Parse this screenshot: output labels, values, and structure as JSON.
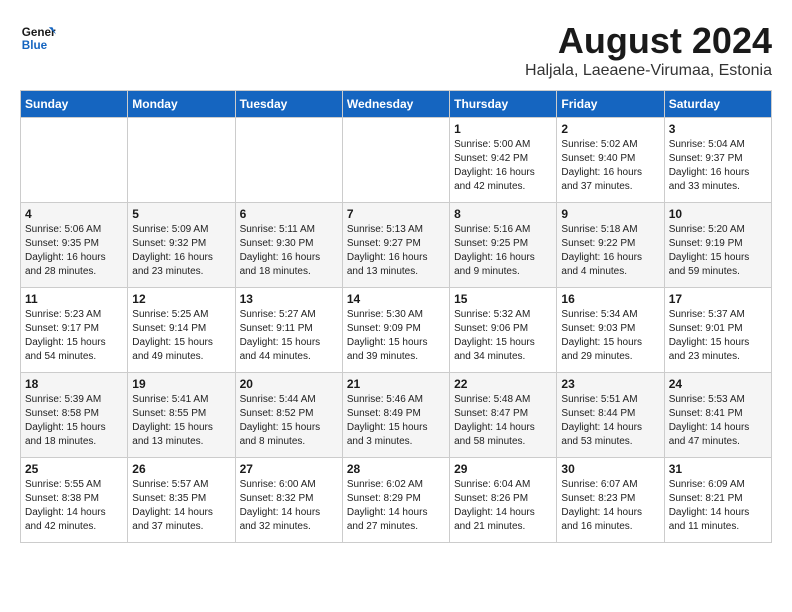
{
  "logo": {
    "line1": "General",
    "line2": "Blue"
  },
  "title": "August 2024",
  "subtitle": "Haljala, Laeaene-Virumaa, Estonia",
  "days_of_week": [
    "Sunday",
    "Monday",
    "Tuesday",
    "Wednesday",
    "Thursday",
    "Friday",
    "Saturday"
  ],
  "weeks": [
    [
      {
        "day": "",
        "info": ""
      },
      {
        "day": "",
        "info": ""
      },
      {
        "day": "",
        "info": ""
      },
      {
        "day": "",
        "info": ""
      },
      {
        "day": "1",
        "info": "Sunrise: 5:00 AM\nSunset: 9:42 PM\nDaylight: 16 hours\nand 42 minutes."
      },
      {
        "day": "2",
        "info": "Sunrise: 5:02 AM\nSunset: 9:40 PM\nDaylight: 16 hours\nand 37 minutes."
      },
      {
        "day": "3",
        "info": "Sunrise: 5:04 AM\nSunset: 9:37 PM\nDaylight: 16 hours\nand 33 minutes."
      }
    ],
    [
      {
        "day": "4",
        "info": "Sunrise: 5:06 AM\nSunset: 9:35 PM\nDaylight: 16 hours\nand 28 minutes."
      },
      {
        "day": "5",
        "info": "Sunrise: 5:09 AM\nSunset: 9:32 PM\nDaylight: 16 hours\nand 23 minutes."
      },
      {
        "day": "6",
        "info": "Sunrise: 5:11 AM\nSunset: 9:30 PM\nDaylight: 16 hours\nand 18 minutes."
      },
      {
        "day": "7",
        "info": "Sunrise: 5:13 AM\nSunset: 9:27 PM\nDaylight: 16 hours\nand 13 minutes."
      },
      {
        "day": "8",
        "info": "Sunrise: 5:16 AM\nSunset: 9:25 PM\nDaylight: 16 hours\nand 9 minutes."
      },
      {
        "day": "9",
        "info": "Sunrise: 5:18 AM\nSunset: 9:22 PM\nDaylight: 16 hours\nand 4 minutes."
      },
      {
        "day": "10",
        "info": "Sunrise: 5:20 AM\nSunset: 9:19 PM\nDaylight: 15 hours\nand 59 minutes."
      }
    ],
    [
      {
        "day": "11",
        "info": "Sunrise: 5:23 AM\nSunset: 9:17 PM\nDaylight: 15 hours\nand 54 minutes."
      },
      {
        "day": "12",
        "info": "Sunrise: 5:25 AM\nSunset: 9:14 PM\nDaylight: 15 hours\nand 49 minutes."
      },
      {
        "day": "13",
        "info": "Sunrise: 5:27 AM\nSunset: 9:11 PM\nDaylight: 15 hours\nand 44 minutes."
      },
      {
        "day": "14",
        "info": "Sunrise: 5:30 AM\nSunset: 9:09 PM\nDaylight: 15 hours\nand 39 minutes."
      },
      {
        "day": "15",
        "info": "Sunrise: 5:32 AM\nSunset: 9:06 PM\nDaylight: 15 hours\nand 34 minutes."
      },
      {
        "day": "16",
        "info": "Sunrise: 5:34 AM\nSunset: 9:03 PM\nDaylight: 15 hours\nand 29 minutes."
      },
      {
        "day": "17",
        "info": "Sunrise: 5:37 AM\nSunset: 9:01 PM\nDaylight: 15 hours\nand 23 minutes."
      }
    ],
    [
      {
        "day": "18",
        "info": "Sunrise: 5:39 AM\nSunset: 8:58 PM\nDaylight: 15 hours\nand 18 minutes."
      },
      {
        "day": "19",
        "info": "Sunrise: 5:41 AM\nSunset: 8:55 PM\nDaylight: 15 hours\nand 13 minutes."
      },
      {
        "day": "20",
        "info": "Sunrise: 5:44 AM\nSunset: 8:52 PM\nDaylight: 15 hours\nand 8 minutes."
      },
      {
        "day": "21",
        "info": "Sunrise: 5:46 AM\nSunset: 8:49 PM\nDaylight: 15 hours\nand 3 minutes."
      },
      {
        "day": "22",
        "info": "Sunrise: 5:48 AM\nSunset: 8:47 PM\nDaylight: 14 hours\nand 58 minutes."
      },
      {
        "day": "23",
        "info": "Sunrise: 5:51 AM\nSunset: 8:44 PM\nDaylight: 14 hours\nand 53 minutes."
      },
      {
        "day": "24",
        "info": "Sunrise: 5:53 AM\nSunset: 8:41 PM\nDaylight: 14 hours\nand 47 minutes."
      }
    ],
    [
      {
        "day": "25",
        "info": "Sunrise: 5:55 AM\nSunset: 8:38 PM\nDaylight: 14 hours\nand 42 minutes."
      },
      {
        "day": "26",
        "info": "Sunrise: 5:57 AM\nSunset: 8:35 PM\nDaylight: 14 hours\nand 37 minutes."
      },
      {
        "day": "27",
        "info": "Sunrise: 6:00 AM\nSunset: 8:32 PM\nDaylight: 14 hours\nand 32 minutes."
      },
      {
        "day": "28",
        "info": "Sunrise: 6:02 AM\nSunset: 8:29 PM\nDaylight: 14 hours\nand 27 minutes."
      },
      {
        "day": "29",
        "info": "Sunrise: 6:04 AM\nSunset: 8:26 PM\nDaylight: 14 hours\nand 21 minutes."
      },
      {
        "day": "30",
        "info": "Sunrise: 6:07 AM\nSunset: 8:23 PM\nDaylight: 14 hours\nand 16 minutes."
      },
      {
        "day": "31",
        "info": "Sunrise: 6:09 AM\nSunset: 8:21 PM\nDaylight: 14 hours\nand 11 minutes."
      }
    ]
  ]
}
